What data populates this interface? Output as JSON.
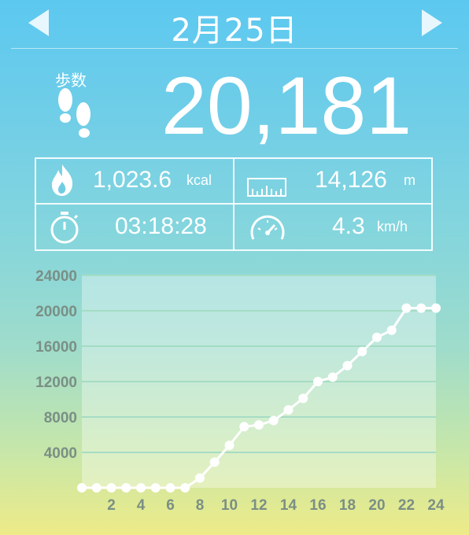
{
  "header": {
    "date": "2月25日",
    "prev_icon": "triangle-left-icon",
    "next_icon": "triangle-right-icon"
  },
  "steps": {
    "label": "歩数",
    "value": "20,181",
    "icon": "footprints-icon"
  },
  "stats": {
    "calories": {
      "value": "1,023.6",
      "unit": "kcal",
      "icon": "flame-icon"
    },
    "distance": {
      "value": "14,126",
      "unit": "m",
      "icon": "ruler-icon"
    },
    "duration": {
      "value": "03:18:28",
      "icon": "stopwatch-icon"
    },
    "speed": {
      "value": "4.3",
      "unit": "km/h",
      "icon": "speedometer-icon"
    }
  },
  "colors": {
    "chart_line": "#ffffff",
    "axis_text": "#7a8f85",
    "gridline": "#a5dcc4"
  },
  "chart_data": {
    "type": "line",
    "x": [
      0,
      1,
      2,
      3,
      4,
      5,
      6,
      7,
      8,
      9,
      10,
      11,
      12,
      13,
      14,
      15,
      16,
      17,
      18,
      19,
      20,
      21,
      22,
      23,
      24
    ],
    "values": [
      0,
      0,
      0,
      0,
      0,
      0,
      0,
      0,
      1100,
      2900,
      4800,
      6900,
      7100,
      7600,
      8800,
      10100,
      12000,
      12500,
      13800,
      15400,
      17000,
      17800,
      20300,
      20300,
      20300
    ],
    "x_ticks": [
      "2",
      "4",
      "6",
      "8",
      "10",
      "12",
      "14",
      "16",
      "18",
      "20",
      "22",
      "24"
    ],
    "y_ticks": [
      "4000",
      "8000",
      "12000",
      "16000",
      "20000",
      "24000"
    ],
    "xlim": [
      0,
      24
    ],
    "ylim": [
      0,
      24000
    ],
    "grid": true
  }
}
